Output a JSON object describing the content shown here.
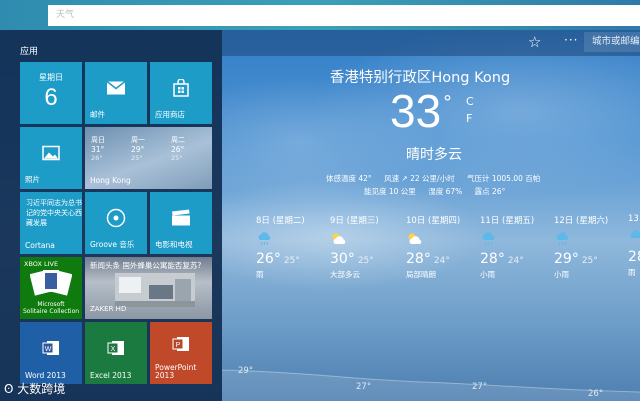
{
  "titlebar": {
    "text": "天气"
  },
  "header": {
    "search_placeholder": "城市或邮编"
  },
  "current": {
    "location": "香港特别行政区Hong Kong",
    "temp": "33",
    "degree": "°",
    "unit_c": "C",
    "unit_f": "F",
    "condition": "晴时多云",
    "details": {
      "feels_like": "体感温度 42°",
      "wind": "风速 ↗ 22 公里/小时",
      "pressure": "气压计 1005.00 百帕",
      "visibility": "能见度 10 公里",
      "humidity": "湿度 67%",
      "dew_point": "露点 26°"
    }
  },
  "forecast": [
    {
      "date": "8日 (星期二)",
      "icon": "cloud-rain-icon",
      "hi": "26°",
      "lo": "25°",
      "cond": "雨"
    },
    {
      "date": "9日 (星期三)",
      "icon": "partly-cloudy-icon",
      "hi": "30°",
      "lo": "25°",
      "cond": "大部多云"
    },
    {
      "date": "10日 (星期四)",
      "icon": "partly-cloudy-icon",
      "hi": "28°",
      "lo": "24°",
      "cond": "局部晴朗"
    },
    {
      "date": "11日 (星期五)",
      "icon": "cloud-rain-icon",
      "hi": "28°",
      "lo": "24°",
      "cond": "小雨"
    },
    {
      "date": "12日 (星期六)",
      "icon": "cloud-rain-icon",
      "hi": "29°",
      "lo": "25°",
      "cond": "小雨"
    },
    {
      "date": "13",
      "icon": "cloud-rain-icon",
      "hi": "28°",
      "lo": "",
      "cond": "雨"
    }
  ],
  "hourly_labels": [
    "29°",
    "27°",
    "27°",
    "26°"
  ],
  "start_menu": {
    "heading": "应用",
    "calendar": {
      "day": "星期日",
      "num": "6"
    },
    "mail": {
      "label": "邮件"
    },
    "store": {
      "label": "应用商店"
    },
    "photos": {
      "label": "照片"
    },
    "hk_weather": {
      "label": "Hong Kong",
      "days": [
        {
          "name": "周日",
          "hi": "31°",
          "lo": "26°"
        },
        {
          "name": "周一",
          "hi": "29°",
          "lo": "25°"
        },
        {
          "name": "周二",
          "hi": "26°",
          "lo": "25°"
        }
      ]
    },
    "cortana": {
      "text": "习近平同志为总书记的党中央关心西藏发展",
      "label": "Cortana"
    },
    "groove": {
      "label": "Groove 音乐"
    },
    "movies": {
      "label": "电影和电视"
    },
    "solitaire": {
      "badge": "XBOX LIVE",
      "title_line1": "Microsoft",
      "title_line2": "Solitaire Collection"
    },
    "news": {
      "headline": "新闻头条 国外蜂巢公寓能否复苏?",
      "source": "ZAKER HD"
    },
    "word": {
      "label": "Word 2013"
    },
    "excel": {
      "label": "Excel 2013"
    },
    "powerpoint": {
      "label": "PowerPoint 2013"
    }
  },
  "watermark": {
    "text": "大数跨境"
  }
}
